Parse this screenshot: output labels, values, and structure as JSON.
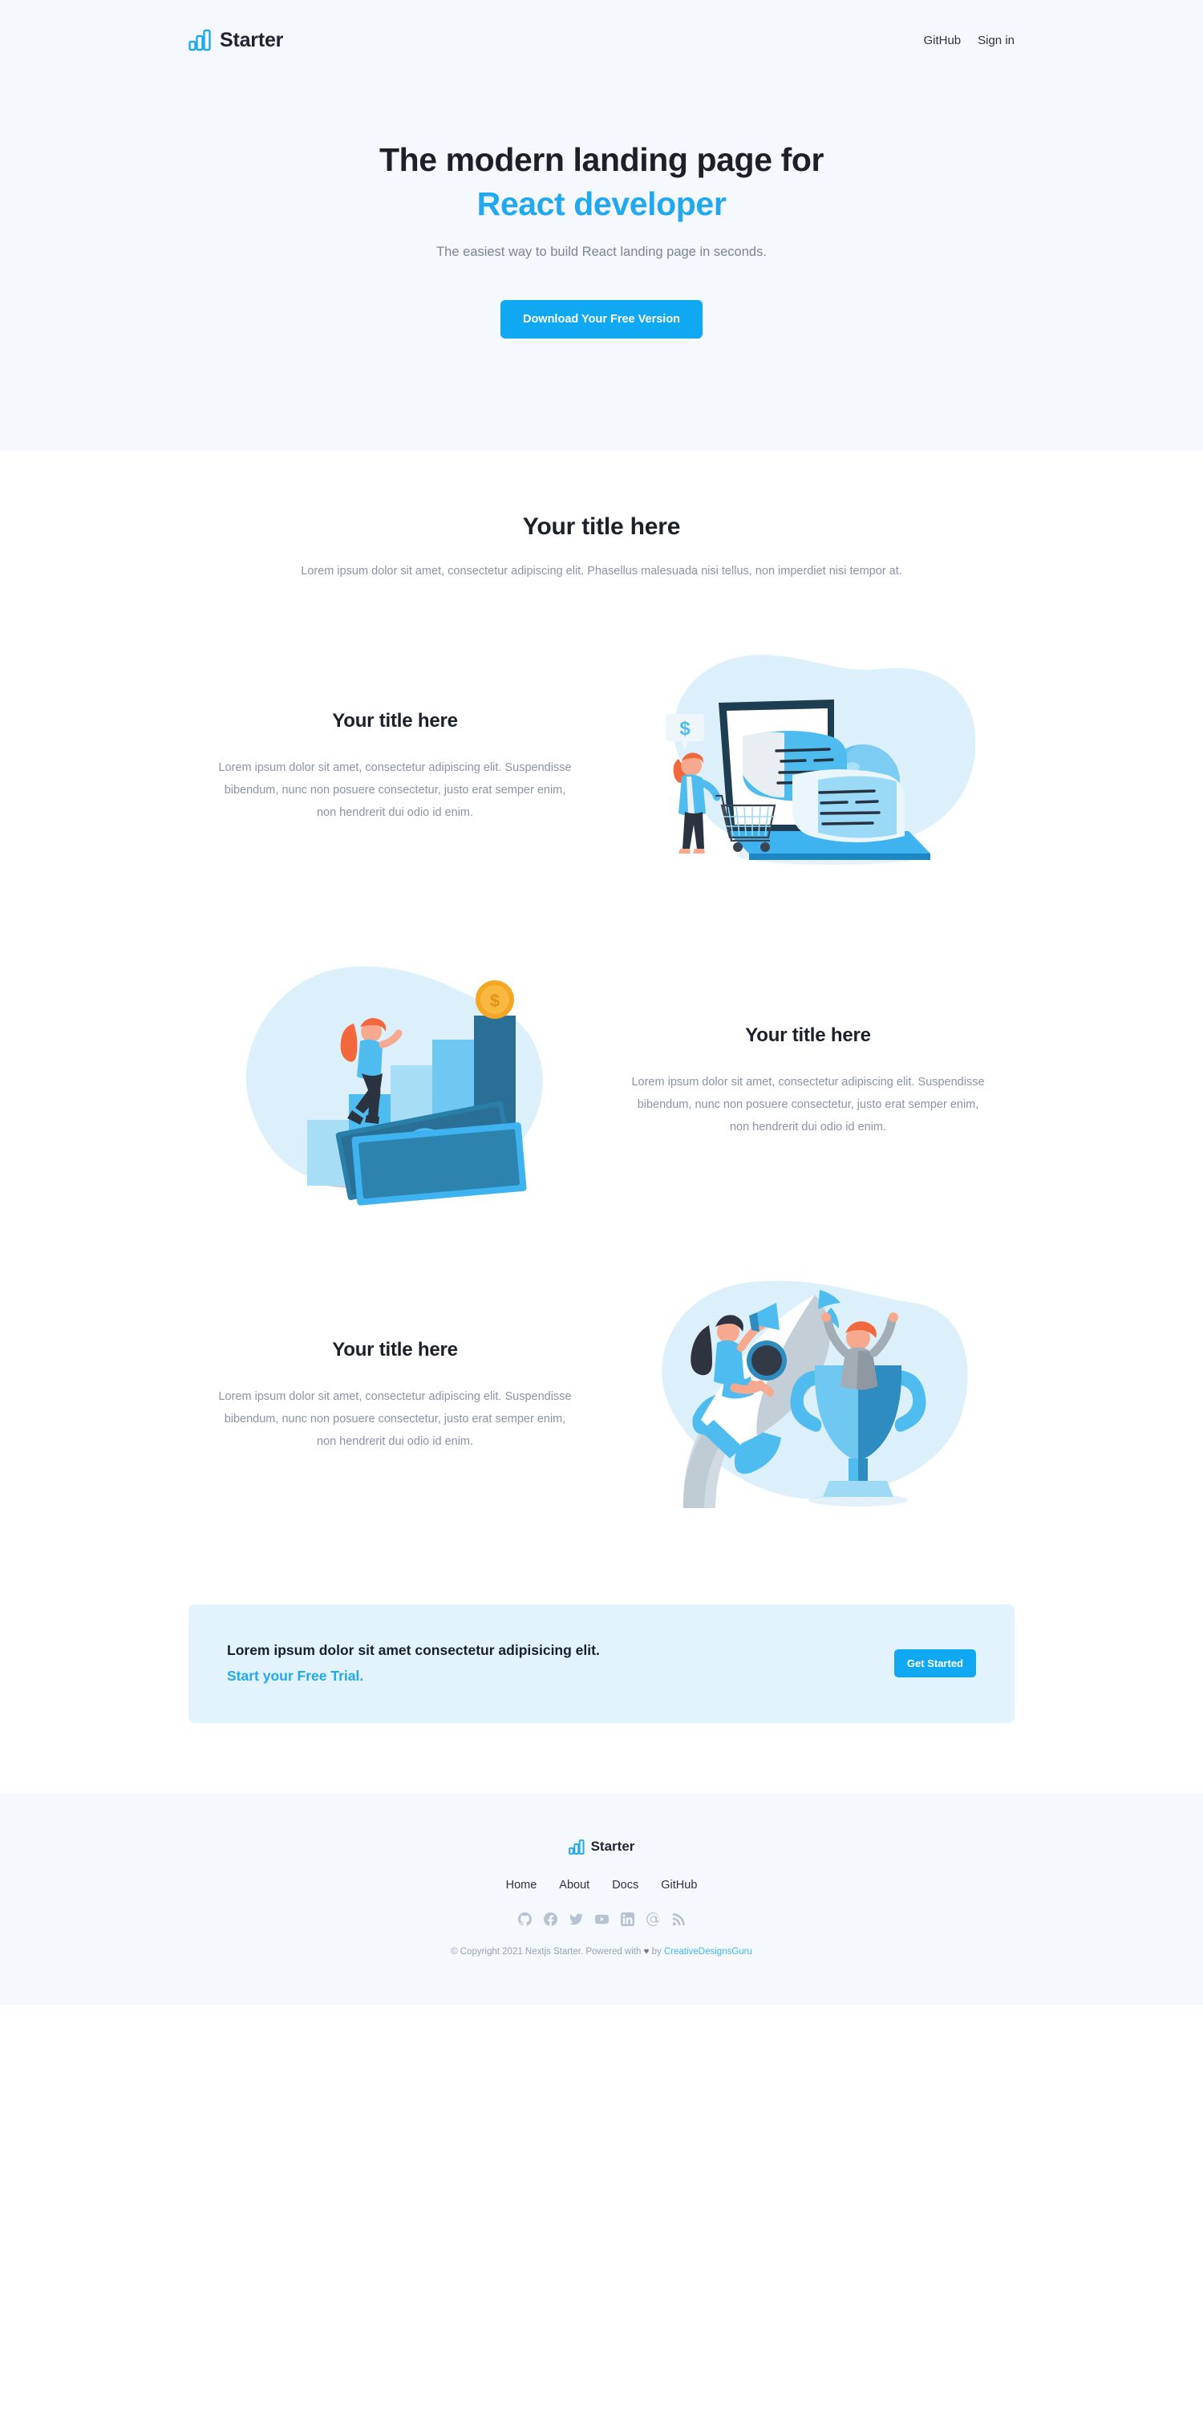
{
  "colors": {
    "accent": "#10a8f2",
    "accent_text": "#21a8f0",
    "hero_bg": "#f5f9fd",
    "banner_bg": "#e3f3fd",
    "heading": "#1b2029",
    "body_text": "#8a93a5",
    "footer_bg": "#f5f9fd",
    "social_icon": "#b6c1d2",
    "blob": "#dcf0fc"
  },
  "header": {
    "brand_name": "Starter",
    "logo_icon": "bar-chart-icon",
    "links": [
      {
        "label": "GitHub"
      },
      {
        "label": "Sign in"
      }
    ]
  },
  "hero": {
    "title_line1": "The modern landing page for",
    "title_line2": "React developer",
    "subtitle": "The easiest way to build React landing page in seconds.",
    "cta_label": "Download Your Free Version"
  },
  "features_section": {
    "title": "Your title here",
    "description": "Lorem ipsum dolor sit amet, consectetur adipiscing elit. Phasellus malesuada nisi tellus, non imperdiet nisi tempor at."
  },
  "features": [
    {
      "title": "Your title here",
      "description": "Lorem ipsum dolor sit amet, consectetur adipiscing elit. Suspendisse bibendum, nunc non posuere consectetur, justo erat semper enim, non hendrerit dui odio id enim.",
      "art": "ecommerce-laptop-illustration",
      "art_side": "right"
    },
    {
      "title": "Your title here",
      "description": "Lorem ipsum dolor sit amet, consectetur adipiscing elit. Suspendisse bibendum, nunc non posuere consectetur, justo erat semper enim, non hendrerit dui odio id enim.",
      "art": "growth-chart-money-illustration",
      "art_side": "left"
    },
    {
      "title": "Your title here",
      "description": "Lorem ipsum dolor sit amet, consectetur adipiscing elit. Suspendisse bibendum, nunc non posuere consectetur, justo erat semper enim, non hendrerit dui odio id enim.",
      "art": "rocket-trophy-illustration",
      "art_side": "right"
    }
  ],
  "banner": {
    "line1": "Lorem ipsum dolor sit amet consectetur adipisicing elit.",
    "line2": "Start your Free Trial.",
    "button_label": "Get Started"
  },
  "footer": {
    "brand_name": "Starter",
    "logo_icon": "bar-chart-icon",
    "nav": [
      {
        "label": "Home"
      },
      {
        "label": "About"
      },
      {
        "label": "Docs"
      },
      {
        "label": "GitHub"
      }
    ],
    "socials": [
      {
        "name": "github-icon"
      },
      {
        "name": "facebook-icon"
      },
      {
        "name": "twitter-icon"
      },
      {
        "name": "youtube-icon"
      },
      {
        "name": "linkedin-icon"
      },
      {
        "name": "email-at-icon"
      },
      {
        "name": "rss-icon"
      }
    ],
    "copyright_prefix": "© Copyright 2021 Nextjs Starter. Powered with ",
    "copyright_heart": "♥",
    "copyright_mid": " by ",
    "copyright_link": "CreativeDesignsGuru"
  }
}
